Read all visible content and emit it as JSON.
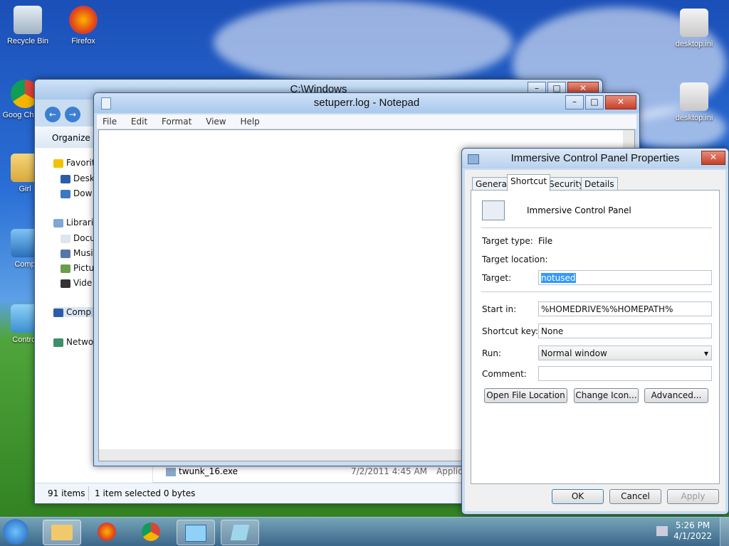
{
  "desktop": {
    "icons": [
      {
        "label": "Recycle Bin"
      },
      {
        "label": "Firefox"
      },
      {
        "label": "Goog Chrom"
      },
      {
        "label": "Girl"
      },
      {
        "label": "Comp"
      },
      {
        "label": "Control"
      },
      {
        "label": "desktop.ini"
      },
      {
        "label": "desktop.ini"
      }
    ]
  },
  "explorer": {
    "title": "C:\\Windows",
    "organize": "Organize ▾",
    "nav": [
      "Favorit",
      "Desk",
      "Dow",
      "Librari",
      "Docu",
      "Musi",
      "Pictu",
      "Vide",
      "Comp",
      "Netwo"
    ],
    "file_row": {
      "name": "twunk_16.exe",
      "date": "7/2/2011 4:45 AM",
      "type": "Applic"
    },
    "status_count": "91 items",
    "status_selected": "1 item selected  0 bytes"
  },
  "notepad": {
    "title": "setuperr.log - Notepad",
    "menu": [
      "File",
      "Edit",
      "Format",
      "View",
      "Help"
    ]
  },
  "props": {
    "title": "Immersive Control Panel Properties",
    "tabs": [
      "General",
      "Shortcut",
      "Security",
      "Details"
    ],
    "name": "Immersive Control Panel",
    "target_type_label": "Target type:",
    "target_type_value": "File",
    "target_location_label": "Target location:",
    "target_label": "Target:",
    "target_value": "notused",
    "start_in_label": "Start in:",
    "start_in_value": "%HOMEDRIVE%%HOMEPATH%",
    "shortcut_key_label": "Shortcut key:",
    "shortcut_key_value": "None",
    "run_label": "Run:",
    "run_value": "Normal window",
    "comment_label": "Comment:",
    "open_file_location": "Open File Location",
    "change_icon": "Change Icon...",
    "advanced": "Advanced...",
    "ok": "OK",
    "cancel": "Cancel",
    "apply": "Apply"
  },
  "taskbar": {
    "time": "5:26 PM",
    "date": "4/1/2022"
  },
  "colors": {
    "selection": "#3399ff",
    "accent": "#2a6fd6"
  }
}
